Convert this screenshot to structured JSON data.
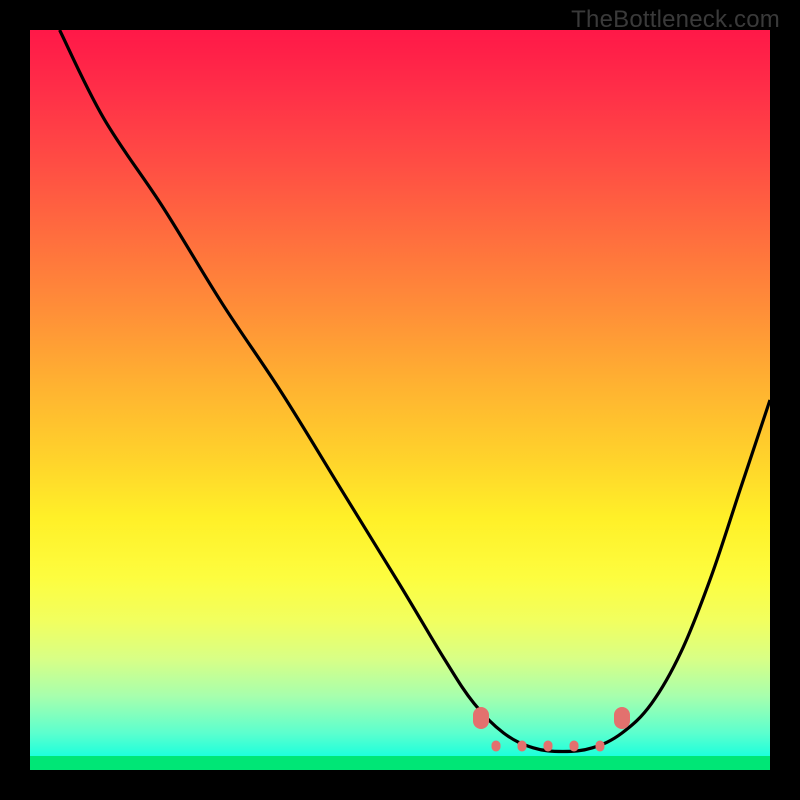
{
  "watermark": "TheBottleneck.com",
  "chart_data": {
    "type": "line",
    "title": "",
    "xlabel": "",
    "ylabel": "",
    "xlim": [
      0,
      100
    ],
    "ylim": [
      0,
      100
    ],
    "series": [
      {
        "name": "bottleneck-curve",
        "x": [
          4,
          10,
          18,
          26,
          34,
          42,
          50,
          56,
          60,
          64,
          68,
          72,
          76,
          80,
          84,
          88,
          92,
          96,
          100
        ],
        "y": [
          100,
          88,
          76,
          63,
          51,
          38,
          25,
          15,
          9,
          5,
          3,
          2.5,
          3,
          5,
          9,
          16,
          26,
          38,
          50
        ]
      }
    ],
    "markers": [
      {
        "name": "flat-zone-left",
        "x": 61,
        "y": 7
      },
      {
        "name": "flat-zone-right",
        "x": 80,
        "y": 7
      }
    ],
    "flat_zone_ticks_x": [
      63,
      66.5,
      70,
      73.5,
      77
    ],
    "background": {
      "type": "vertical-gradient",
      "stops": [
        {
          "pos": 0,
          "color": "#ff1848"
        },
        {
          "pos": 50,
          "color": "#ffd32b"
        },
        {
          "pos": 80,
          "color": "#f1ff60"
        },
        {
          "pos": 100,
          "color": "#00ffc8"
        }
      ]
    }
  }
}
